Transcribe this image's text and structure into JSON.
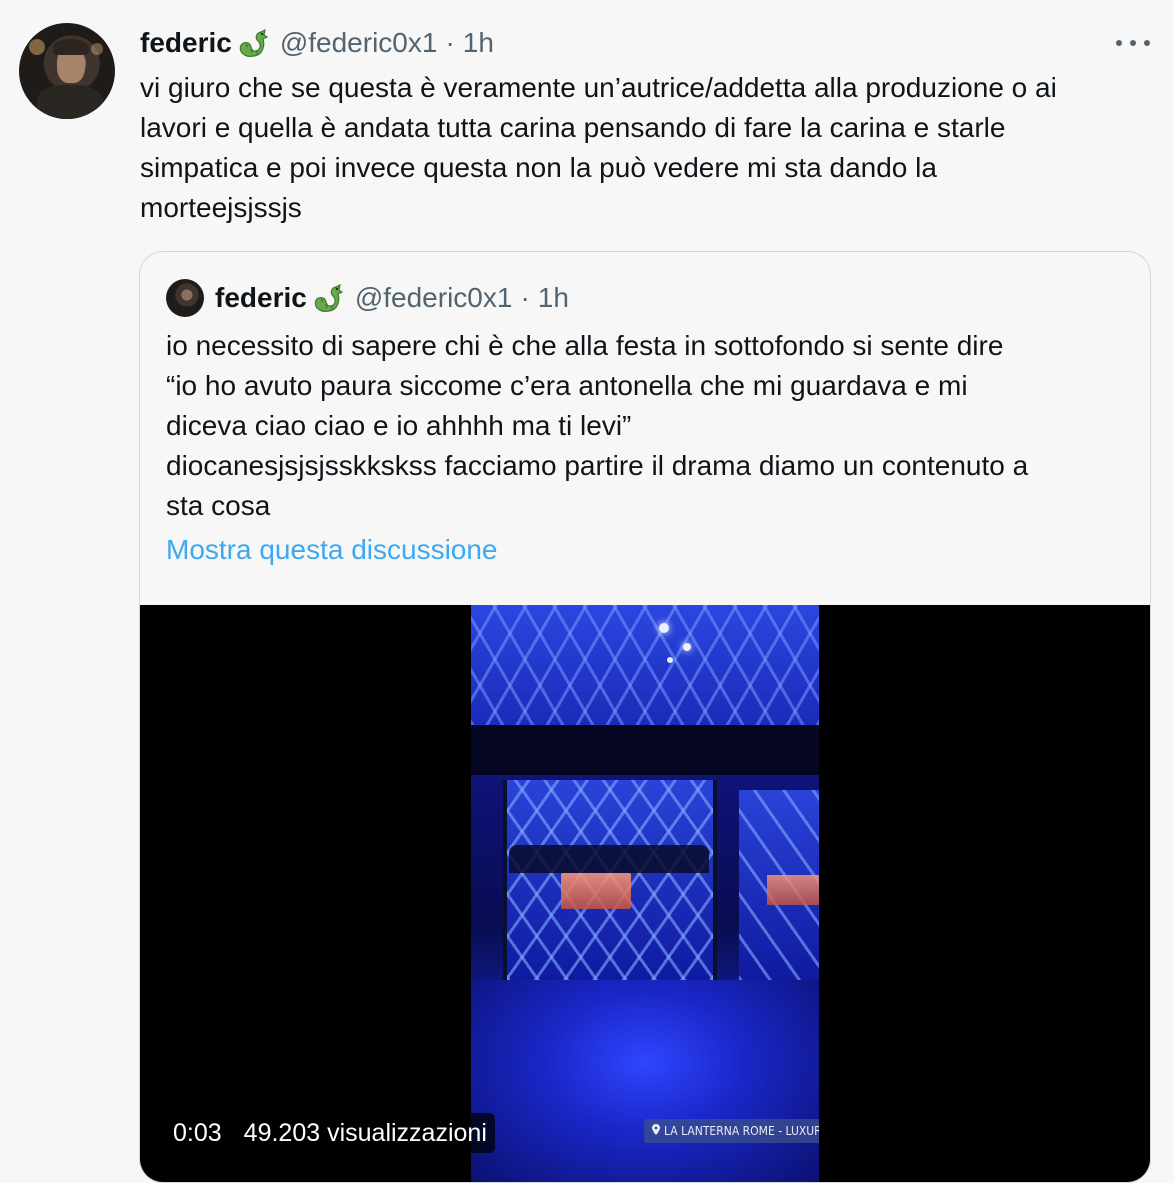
{
  "tweet": {
    "display_name": "federic",
    "name_emoji_icon": "dragon-emoji",
    "handle": "@federic0x1",
    "separator": "·",
    "time": "1h",
    "text_lines": [
      "vi giuro che se questa è veramente un’autrice/addetta alla produzione o ai",
      "lavori e quella è andata tutta carina pensando di fare la carina e starle",
      "simpatica e poi invece questa non la può vedere mi sta dando la",
      "morteejsjssjs"
    ]
  },
  "quoted": {
    "display_name": "federic",
    "name_emoji_icon": "dragon-emoji",
    "handle": "@federic0x1",
    "separator": "·",
    "time": "1h",
    "text_lines": [
      "io necessito di sapere chi è che alla festa in sottofondo si sente dire",
      "“io ho avuto paura siccome c’era antonella che mi guardava e mi",
      "diceva ciao ciao e io ahhhh ma ti levi”",
      "diocanesjsjsjsskkskss facciamo partire il drama diamo un contenuto a",
      "sta cosa"
    ],
    "show_thread": "Mostra questa discussione",
    "video": {
      "elapsed": "0:03",
      "views": "49.203 visualizzazioni",
      "location_badge": "LA LANTERNA ROME - LUXURY EVENTS",
      "location_icon": "pin-icon"
    }
  },
  "colors": {
    "background": "#f7f7f7",
    "text": "#0f1419",
    "secondary": "#536471",
    "link": "#1d9bf0",
    "border": "#cfd9de"
  }
}
